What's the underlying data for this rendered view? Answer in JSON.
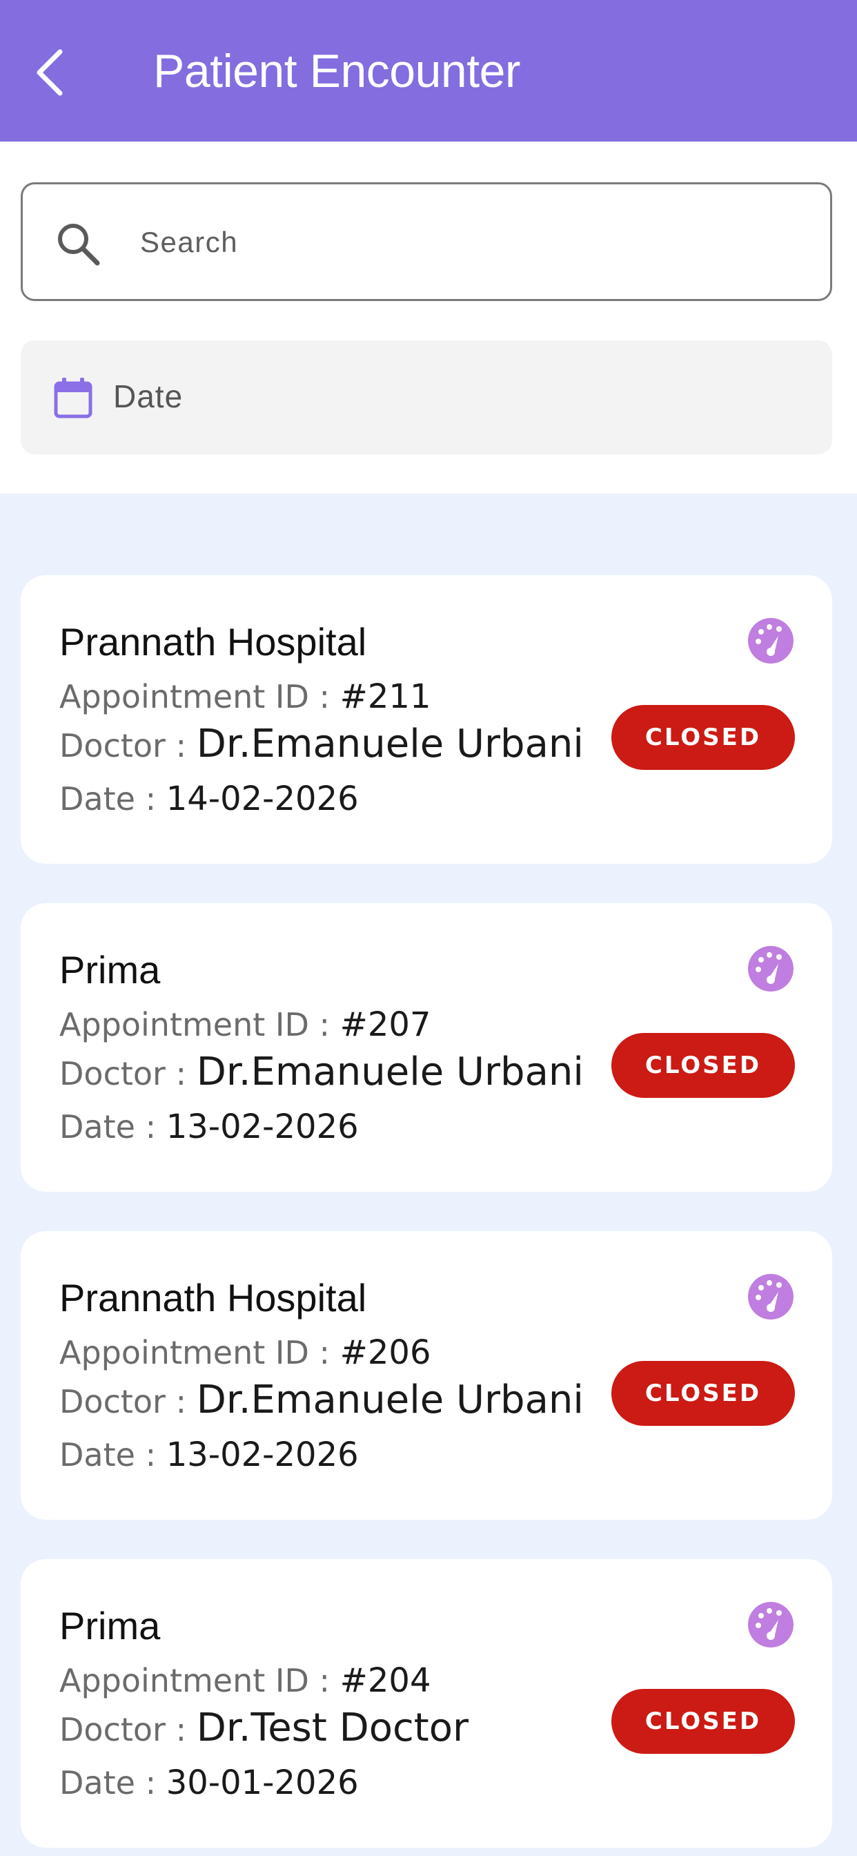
{
  "header": {
    "title": "Patient Encounter"
  },
  "search": {
    "placeholder": "Search"
  },
  "date_filter": {
    "label": "Date"
  },
  "labels": {
    "appointment_id": "Appointment ID : ",
    "doctor": "Doctor : ",
    "date": "Date : "
  },
  "colors": {
    "appbar": "#836ddf",
    "accent_icon": "#c07ee0",
    "closed_badge": "#cc1a14",
    "list_bg": "#ebf1fd"
  },
  "encounters": [
    {
      "hospital": "Prannath Hospital",
      "appointment_id": "#211",
      "doctor": "Dr.Emanuele Urbani",
      "date": "14-02-2026",
      "status": "CLOSED",
      "icon": "dashboard-gauge-icon"
    },
    {
      "hospital": "Prima",
      "appointment_id": "#207",
      "doctor": "Dr.Emanuele Urbani",
      "date": "13-02-2026",
      "status": "CLOSED",
      "icon": "dashboard-gauge-icon"
    },
    {
      "hospital": "Prannath Hospital",
      "appointment_id": "#206",
      "doctor": "Dr.Emanuele Urbani",
      "date": "13-02-2026",
      "status": "CLOSED",
      "icon": "dashboard-gauge-icon"
    },
    {
      "hospital": "Prima",
      "appointment_id": "#204",
      "doctor": "Dr.Test Doctor",
      "date": "30-01-2026",
      "status": "CLOSED",
      "icon": "dashboard-gauge-icon"
    }
  ]
}
